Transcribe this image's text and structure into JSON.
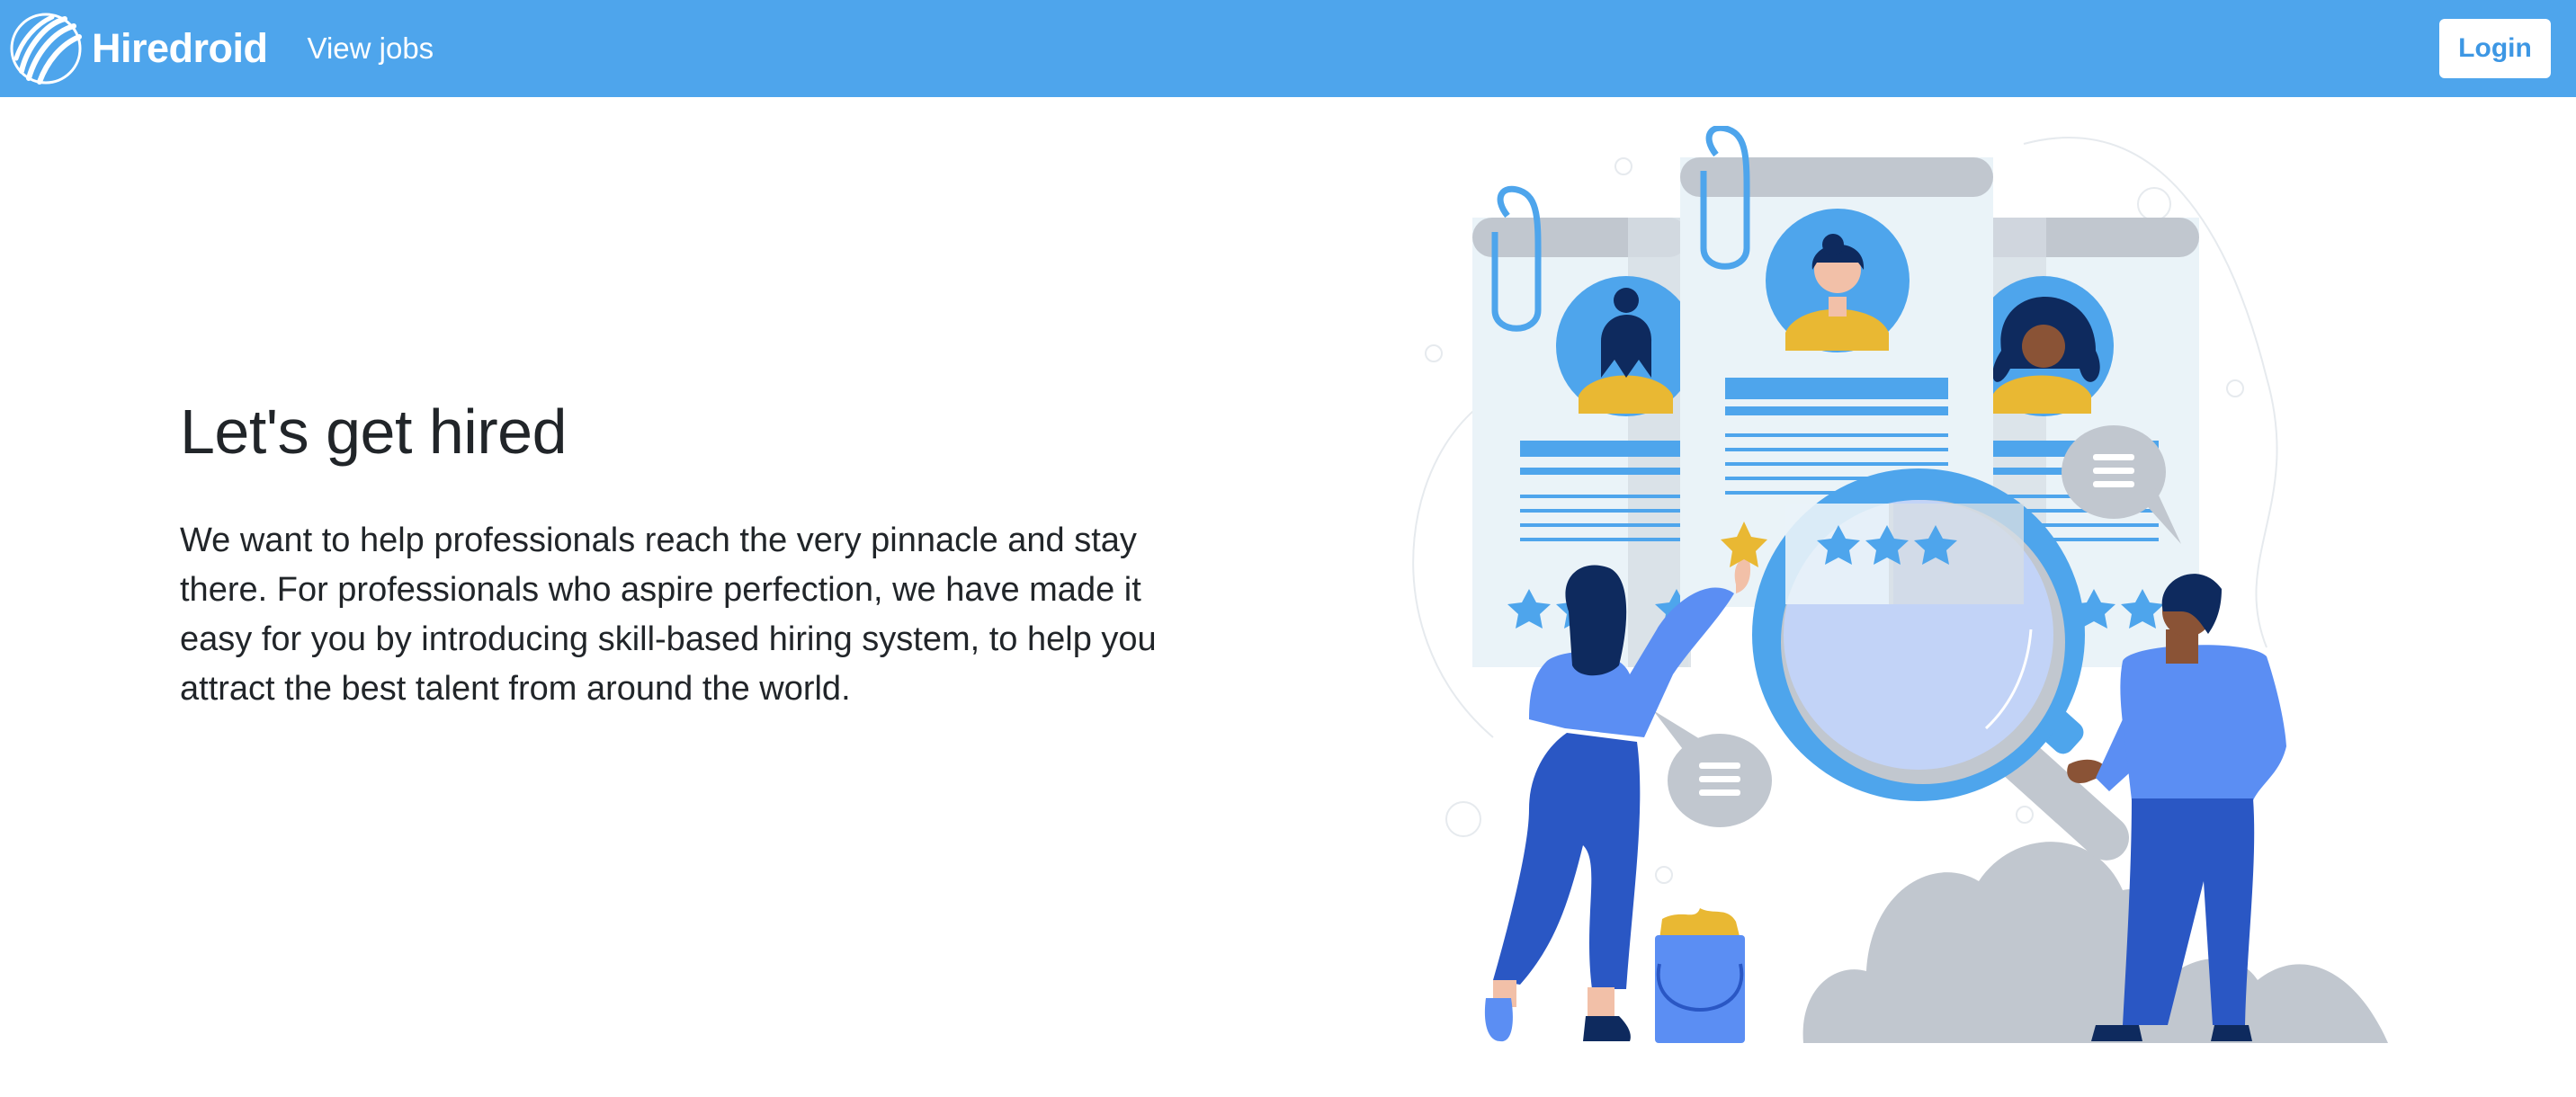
{
  "navbar": {
    "brand_name": "Hiredroid",
    "links": [
      {
        "label": "View jobs"
      }
    ],
    "login_label": "Login",
    "background_color": "#4ea5ec"
  },
  "hero": {
    "title": "Let's get hired",
    "description": "We want to help professionals reach the very pinnacle and stay there. For professionals who aspire perfection, we have made it easy for you by introducing skill-based hiring system, to help you attract the best talent from around the world."
  },
  "illustration": {
    "icons": [
      "resume-card-icon",
      "magnifying-glass-icon",
      "star-icon",
      "chat-bubble-icon",
      "paper-clip-icon",
      "person-icon",
      "bucket-icon",
      "cloud-icon"
    ],
    "colors": {
      "primary": "#4ea5ec",
      "dark_blue": "#2a57c4",
      "gray": "#c1c7cf",
      "yellow": "#e9b833"
    }
  }
}
